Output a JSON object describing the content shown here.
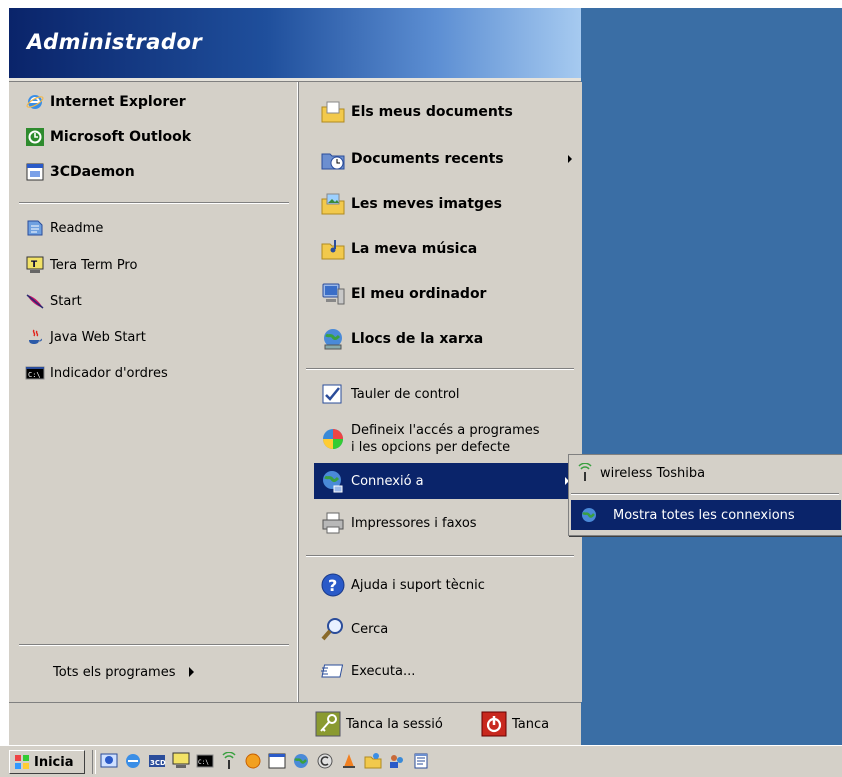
{
  "header": {
    "user_name": "Administrador"
  },
  "pinned": [
    {
      "label": "Internet Explorer",
      "icon": "internet-explorer-icon"
    },
    {
      "label": "Microsoft Outlook",
      "icon": "outlook-icon"
    },
    {
      "label": "3CDaemon",
      "icon": "3cdaemon-icon"
    }
  ],
  "recent": [
    {
      "label": "Readme",
      "icon": "document-icon"
    },
    {
      "label": "Tera Term Pro",
      "icon": "tera-term-icon"
    },
    {
      "label": "Start",
      "icon": "feather-icon"
    },
    {
      "label": "Java Web Start",
      "icon": "java-icon"
    },
    {
      "label": "Indicador d'ordres",
      "icon": "command-prompt-icon"
    }
  ],
  "all_programs": {
    "label": "Tots els programes"
  },
  "places": [
    {
      "label": "Els meus documents",
      "icon": "my-documents-icon"
    },
    {
      "label": "Documents recents",
      "icon": "recent-documents-icon"
    },
    {
      "label": "Les meves imatges",
      "icon": "my-pictures-icon"
    },
    {
      "label": "La meva música",
      "icon": "my-music-icon"
    },
    {
      "label": "El meu ordinador",
      "icon": "my-computer-icon"
    },
    {
      "label": "Llocs de la xarxa",
      "icon": "network-places-icon"
    }
  ],
  "system": {
    "control_panel": "Tauler de control",
    "defaults_line1": "Defineix l'accés a programes",
    "defaults_line2": "i les opcions per defecte",
    "connect_to": "Connexió a",
    "printers": "Impressores i faxos"
  },
  "support": {
    "help": "Ajuda i suport tècnic",
    "search": "Cerca",
    "run": "Executa..."
  },
  "footer": {
    "logoff": "Tanca la sessió",
    "shutdown": "Tanca"
  },
  "submenu": {
    "items": [
      {
        "label": "wireless Toshiba",
        "icon": "wireless-icon"
      },
      {
        "label": "Mostra totes les connexions",
        "icon": "network-connections-icon"
      }
    ]
  },
  "taskbar": {
    "start_label": "Inicia"
  },
  "colors": {
    "highlight": "#0a246a",
    "desktop": "#3a6ea5",
    "menu_bg": "#d4d0c8"
  }
}
